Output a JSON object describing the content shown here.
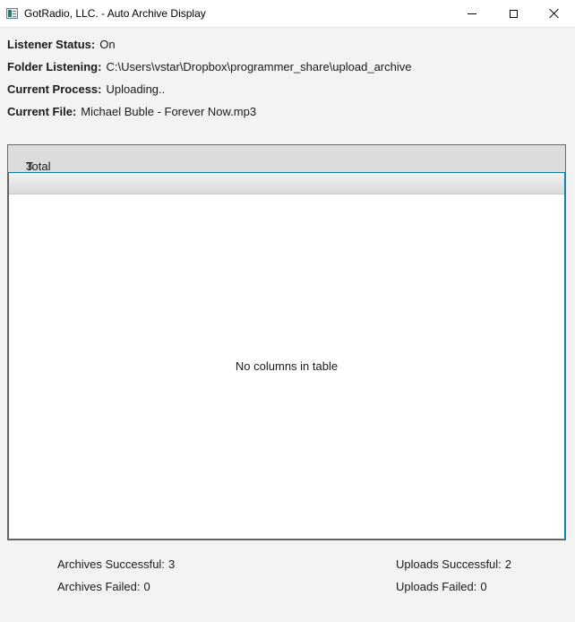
{
  "window": {
    "title": "GotRadio, LLC. - Auto Archive Display"
  },
  "status": {
    "listener_status_label": "Listener Status:",
    "listener_status_value": "On",
    "folder_listening_label": "Folder Listening:",
    "folder_listening_value": "C:\\Users\\vstar\\Dropbox\\programmer_share\\upload_archive",
    "current_process_label": "Current Process:",
    "current_process_value": "Uploading..",
    "current_file_label": "Current File:",
    "current_file_value": "Michael Buble - Forever Now.mp3"
  },
  "panel": {
    "total_processed_label": "Total Processed:",
    "total_processed_value": "3",
    "table_placeholder": "No columns in table"
  },
  "stats": {
    "archives_successful_label": "Archives Successful:",
    "archives_successful_value": "3",
    "archives_failed_label": "Archives Failed:",
    "archives_failed_value": "0",
    "uploads_successful_label": "Uploads Successful:",
    "uploads_successful_value": "2",
    "uploads_failed_label": "Uploads Failed:",
    "uploads_failed_value": "0"
  },
  "colors": {
    "table_focus_border": "#0d79a8",
    "panel_background": "#dcdcdc",
    "window_background": "#f3f3f3"
  },
  "icons": {
    "app": "app-window-icon",
    "minimize": "minimize-icon",
    "maximize": "maximize-icon",
    "close": "close-icon"
  }
}
